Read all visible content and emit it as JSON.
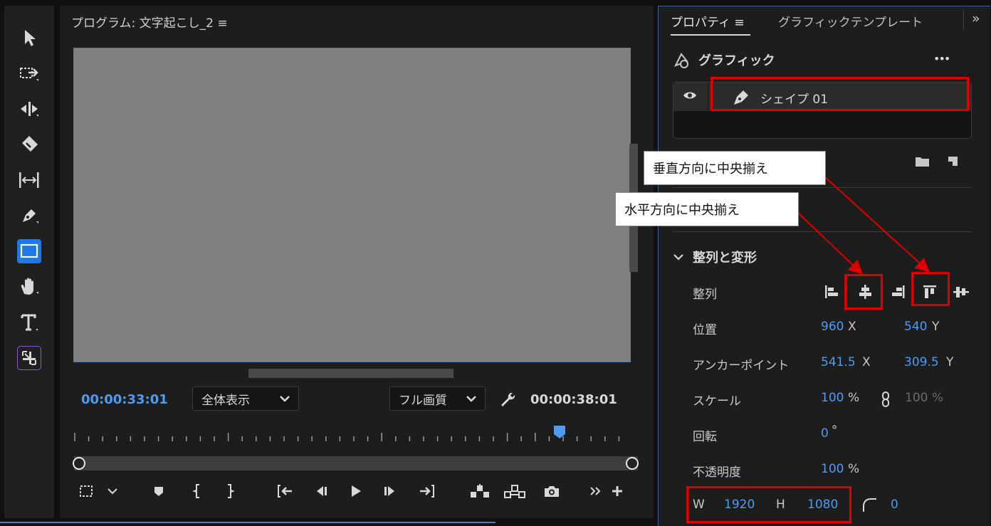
{
  "monitor": {
    "title": "プログラム: 文字起こし_2 ≡",
    "timecode_current": "00:00:33:01",
    "zoom_select": "全体表示",
    "quality_select": "フル画質",
    "timecode_duration": "00:00:38:01"
  },
  "properties": {
    "tab_properties": "プロパティ ≡",
    "tab_graphic_templates": "グラフィックテンプレート",
    "tab_more": "»",
    "section_graphic": "グラフィック",
    "more_menu": "•••",
    "layer_name": "シェイプ 01",
    "section_align_transform": "整列と変形",
    "align_label": "整列",
    "position_label": "位置",
    "position_x": "960",
    "position_y": "540",
    "anchor_label": "アンカーポイント",
    "anchor_x": "541.5",
    "anchor_y": "309.5",
    "scale_label": "スケール",
    "scale_value": "100",
    "scale_unit": "%",
    "scale_linked_value": "100 %",
    "rotation_label": "回転",
    "rotation_value": "0",
    "rotation_unit": "°",
    "opacity_label": "不透明度",
    "opacity_value": "100",
    "opacity_unit": "%",
    "w_label": "W",
    "w_value": "1920",
    "h_label": "H",
    "h_value": "1080",
    "corner_value": "0",
    "x_axis": "X",
    "y_axis": "Y"
  },
  "annotations": {
    "vertical_center": "垂直方向に中央揃え",
    "horizontal_center": "水平方向に中央揃え"
  },
  "colors": {
    "accent_blue": "#4d9cf0",
    "highlight_red": "#e00000",
    "selected_tool": "#1e78e6"
  },
  "icons": [
    "selection-icon",
    "track-select-icon",
    "ripple-edit-icon",
    "razor-icon",
    "slip-icon",
    "pen-icon",
    "rectangle-icon",
    "hand-icon",
    "type-icon",
    "auto-reframe-icon"
  ]
}
